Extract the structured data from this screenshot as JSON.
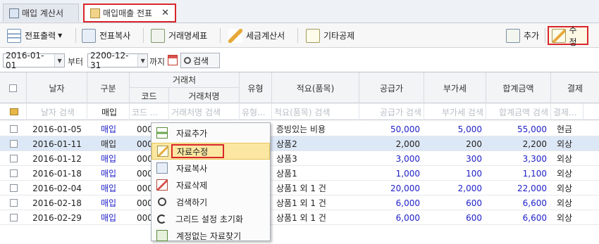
{
  "tabs": [
    {
      "label": "매입 계산서"
    },
    {
      "label": "매입매출 전표",
      "close": "✕"
    }
  ],
  "toolbar": {
    "slip_print": "전표출력",
    "slip_copy": "전표복사",
    "trade_statement": "거래명세표",
    "tax_invoice": "세금계산서",
    "other_deduction": "기타공제",
    "add": "추가",
    "edit": "수정"
  },
  "filter": {
    "date_from": "2016-01-01",
    "from_label": "부터",
    "date_to": "2200-12-31",
    "to_label": "까지",
    "search_label": "검색"
  },
  "grid": {
    "headers": {
      "date": "날자",
      "type": "구분",
      "client_group": "거래처",
      "code": "코드",
      "client_name": "거래처명",
      "kind": "유형",
      "summary": "적요(품목)",
      "supply": "공급가",
      "vat": "부가세",
      "total": "합계금액",
      "payment": "결제"
    },
    "filter_row": {
      "date": "날자 검색",
      "type": "매입",
      "code": "코드 ...",
      "client_name": "거래처명 검색",
      "kind": "유형...",
      "summary": "적요(품목) 검색",
      "supply": "공급가 검색",
      "vat": "부가세 검색",
      "total": "합계금액 검색",
      "payment": "결제..."
    },
    "rows": [
      {
        "date": "2016-01-05",
        "type": "매입",
        "code": "000",
        "summary": "증빙있는 비용",
        "supply": "50,000",
        "vat": "5,000",
        "total": "55,000",
        "payment": "현금"
      },
      {
        "date": "2016-01-11",
        "type": "매입",
        "code": "000",
        "summary": "상품2",
        "supply": "2,000",
        "vat": "200",
        "total": "2,200",
        "payment": "외상"
      },
      {
        "date": "2016-01-12",
        "type": "매입",
        "code": "000",
        "summary": "상품3",
        "supply": "3,000",
        "vat": "300",
        "total": "3,300",
        "payment": "외상"
      },
      {
        "date": "2016-01-18",
        "type": "매입",
        "code": "000",
        "summary": "상품1",
        "supply": "1,000",
        "vat": "100",
        "total": "1,100",
        "payment": "외상"
      },
      {
        "date": "2016-02-04",
        "type": "매입",
        "code": "000",
        "summary": "상품1 외 1 건",
        "supply": "20,000",
        "vat": "2,000",
        "total": "22,000",
        "payment": "외상"
      },
      {
        "date": "2016-02-18",
        "type": "매입",
        "code": "000",
        "summary": "상품1 외 1 건",
        "supply": "6,000",
        "vat": "600",
        "total": "6,600",
        "payment": "외상"
      },
      {
        "date": "2016-02-29",
        "type": "매입",
        "code": "000",
        "summary": "상품1 외 1 건",
        "supply": "6,000",
        "vat": "600",
        "total": "6,600",
        "payment": "외상"
      }
    ]
  },
  "context_menu": {
    "items": [
      {
        "label": "자료추가",
        "icon": "add-data-icon"
      },
      {
        "label": "자료수정",
        "icon": "edit-data-icon"
      },
      {
        "label": "자료복사",
        "icon": "copy-data-icon"
      },
      {
        "label": "자료삭제",
        "icon": "delete-data-icon"
      },
      {
        "label": "검색하기",
        "icon": "search-icon"
      },
      {
        "label": "그리드 설정 초기화",
        "icon": "refresh-icon"
      },
      {
        "label": "계정없는 자료찾기",
        "icon": "find-icon"
      }
    ]
  },
  "colors": {
    "highlight_red": "#d9262b",
    "value_blue": "#1d1dc7",
    "menu_hover": "#fbe7a1"
  }
}
